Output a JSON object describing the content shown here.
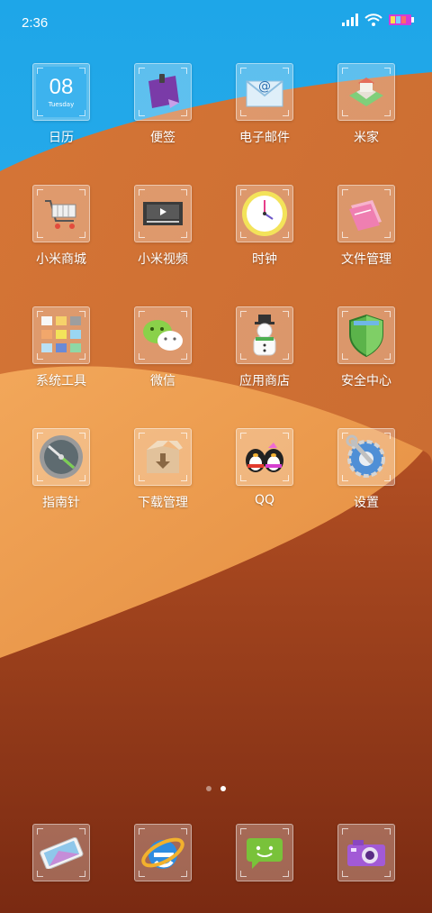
{
  "status_bar": {
    "time": "2:36",
    "icons": [
      "signal-icon",
      "wifi-icon",
      "battery-icon"
    ]
  },
  "calendar_tile": {
    "day": "08",
    "weekday": "Tuesday"
  },
  "apps": [
    {
      "id": "calendar",
      "label": "日历",
      "icon": "calendar-icon"
    },
    {
      "id": "notes",
      "label": "便签",
      "icon": "notes-icon"
    },
    {
      "id": "email",
      "label": "电子邮件",
      "icon": "email-icon"
    },
    {
      "id": "mijia",
      "label": "米家",
      "icon": "mijia-home-icon"
    },
    {
      "id": "mi-store",
      "label": "小米商城",
      "icon": "shopping-cart-icon"
    },
    {
      "id": "mi-video",
      "label": "小米视频",
      "icon": "video-player-icon"
    },
    {
      "id": "clock",
      "label": "时钟",
      "icon": "clock-icon"
    },
    {
      "id": "file-manager",
      "label": "文件管理",
      "icon": "folder-icon"
    },
    {
      "id": "system-tools",
      "label": "系统工具",
      "icon": "tools-folder-icon"
    },
    {
      "id": "wechat",
      "label": "微信",
      "icon": "wechat-icon"
    },
    {
      "id": "app-store",
      "label": "应用商店",
      "icon": "app-store-icon"
    },
    {
      "id": "security",
      "label": "安全中心",
      "icon": "shield-icon"
    },
    {
      "id": "compass",
      "label": "指南针",
      "icon": "compass-icon"
    },
    {
      "id": "downloads",
      "label": "下载管理",
      "icon": "download-box-icon"
    },
    {
      "id": "qq",
      "label": "QQ",
      "icon": "qq-penguin-icon"
    },
    {
      "id": "settings",
      "label": "设置",
      "icon": "settings-icon"
    }
  ],
  "pager": {
    "pages": 2,
    "current": 2
  },
  "dock": [
    {
      "id": "phone",
      "icon": "phone-icon"
    },
    {
      "id": "browser",
      "icon": "browser-icon"
    },
    {
      "id": "messages",
      "icon": "messages-icon"
    },
    {
      "id": "camera",
      "icon": "camera-icon"
    }
  ],
  "colors": {
    "sky": "#2aa5e3",
    "sand_light": "#f0a24e",
    "sand_dark": "#8a3418"
  }
}
